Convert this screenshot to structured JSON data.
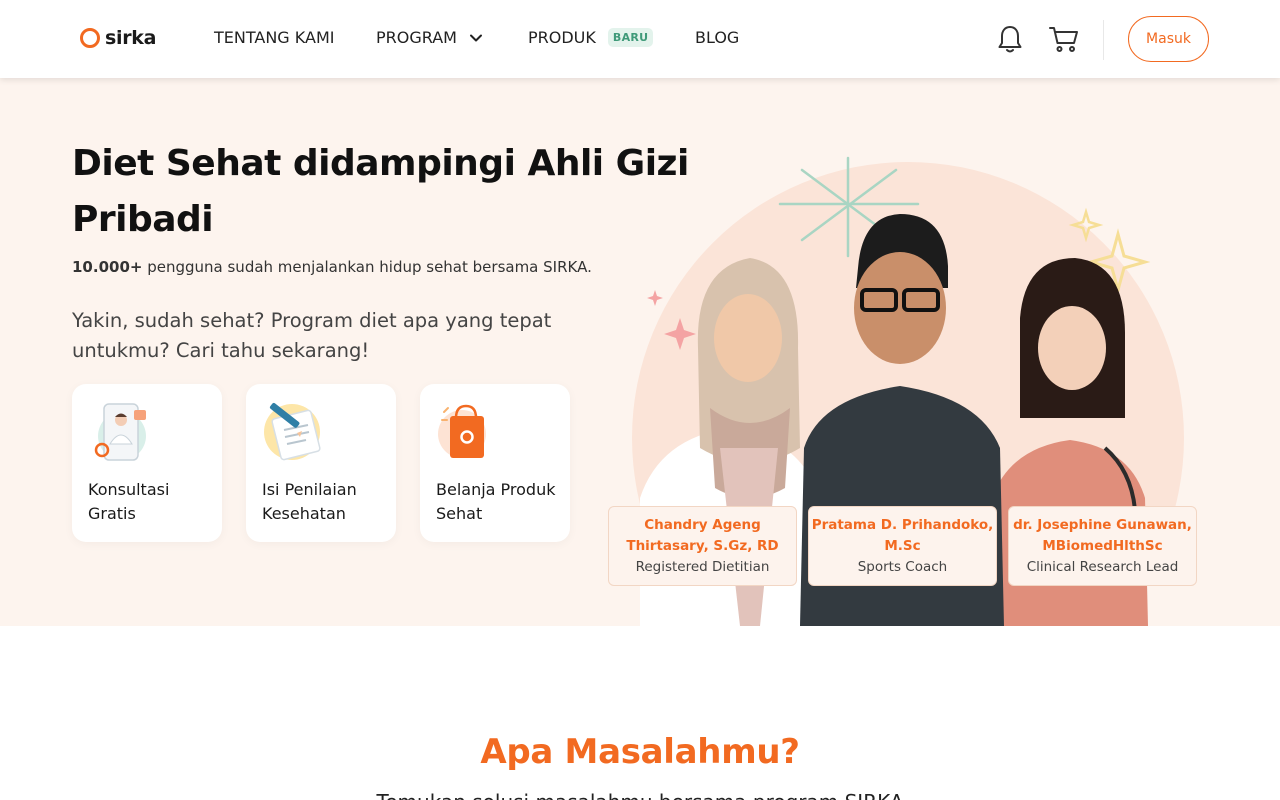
{
  "header": {
    "logo_text": "sirka",
    "nav": [
      {
        "label": "TENTANG KAMI"
      },
      {
        "label": "PROGRAM"
      },
      {
        "label": "PRODUK",
        "badge": "BARU"
      },
      {
        "label": "BLOG"
      }
    ],
    "icons": [
      "bell-icon",
      "cart-icon"
    ],
    "login_label": "Masuk"
  },
  "hero": {
    "title": "Diet Sehat didampingi Ahli Gizi Pribadi",
    "stat_bold": "10.000+",
    "stat_text": " pengguna sudah menjalankan hidup sehat bersama SIRKA.",
    "question": "Yakin, sudah sehat? Program diet apa yang tepat untukmu? Cari tahu sekarang!",
    "cards": [
      {
        "label": "Konsultasi Gratis",
        "icon": "doctor-phone-icon"
      },
      {
        "label": "Isi Penilaian Kesehatan",
        "icon": "clipboard-pencil-icon"
      },
      {
        "label": "Belanja Produk Sehat",
        "icon": "shopping-bag-icon"
      }
    ],
    "experts": [
      {
        "name": "Chandry Ageng Thirtasary, S.Gz, RD",
        "role": "Registered Dietitian"
      },
      {
        "name": "Pratama D. Prihandoko, M.Sc",
        "role": "Sports Coach"
      },
      {
        "name": "dr. Josephine Gunawan, MBiomedHlthSc",
        "role": "Clinical Research Lead"
      }
    ]
  },
  "problems": {
    "title": "Apa Masalahmu?",
    "subtitle": "Temukan solusi masalahmu bersama program SIRKA"
  },
  "colors": {
    "brand": "#f26a21",
    "hero_bg": "#fdf4ee",
    "badge_bg": "#e3f3ec",
    "badge_text": "#3f9a79"
  }
}
